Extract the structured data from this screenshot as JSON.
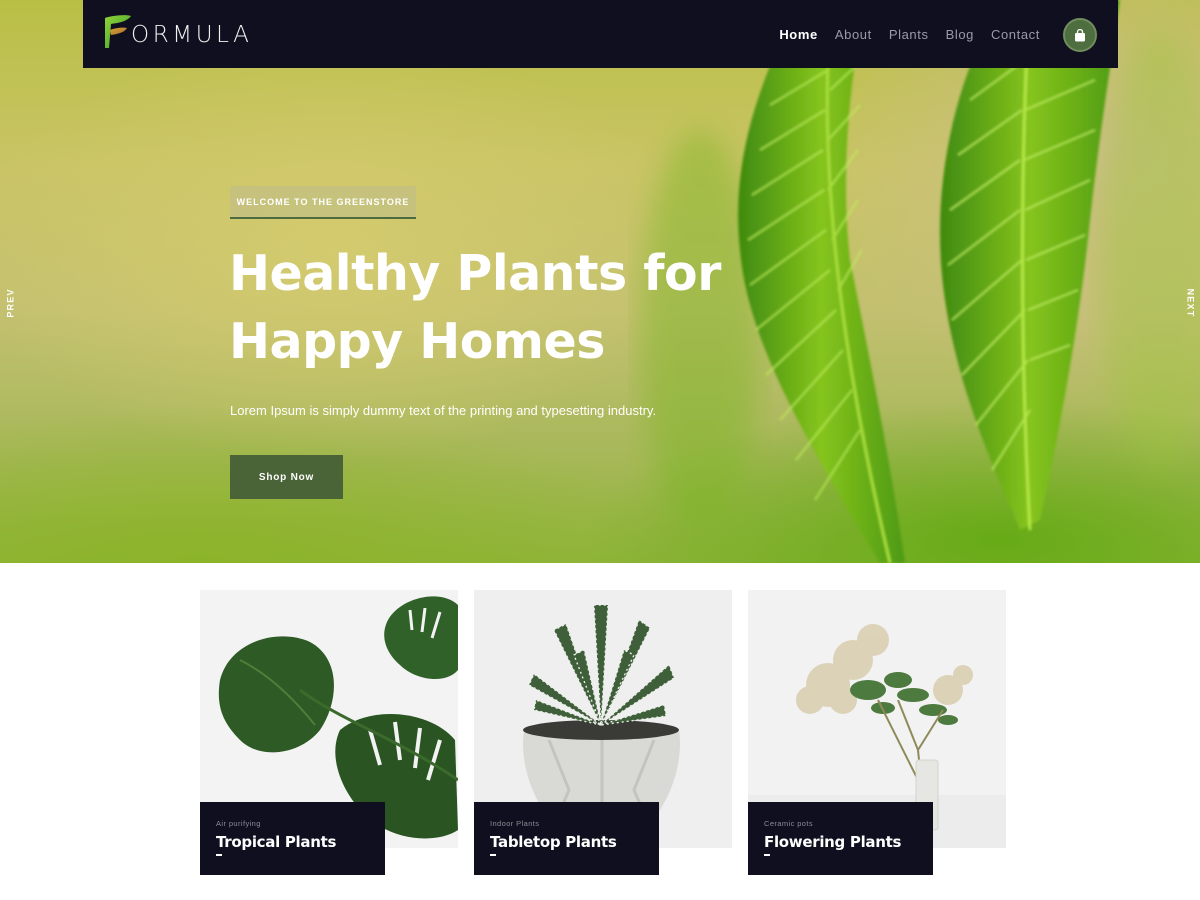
{
  "brand": {
    "logo_text": "ORMULA",
    "logo_letter": "F"
  },
  "nav": {
    "items": [
      {
        "label": "Home",
        "active": true
      },
      {
        "label": "About",
        "active": false
      },
      {
        "label": "Plants",
        "active": false
      },
      {
        "label": "Blog",
        "active": false
      },
      {
        "label": "Contact",
        "active": false
      }
    ],
    "cart_icon": "shopping-bag-icon"
  },
  "slider": {
    "prev_label": "PREV",
    "next_label": "NEXT"
  },
  "hero": {
    "badge": "WELCOME TO THE GREENSTORE",
    "title": "Healthy Plants for Happy Homes",
    "subtitle": "Lorem Ipsum is simply dummy text of the printing and typesetting industry.",
    "button": "Shop Now"
  },
  "categories": [
    {
      "kicker": "Air purifying",
      "title": "Tropical Plants",
      "image": "monstera-leaf-photo"
    },
    {
      "kicker": "Indoor Plants",
      "title": "Tabletop Plants",
      "image": "succulent-pot-photo"
    },
    {
      "kicker": "Ceramic pots",
      "title": "Flowering Plants",
      "image": "flowers-vase-photo"
    }
  ],
  "colors": {
    "navbar": "#100f1f",
    "accent_green": "#4a6337",
    "cart_button": "#4e6e3f",
    "card_label": "#100f1f"
  }
}
